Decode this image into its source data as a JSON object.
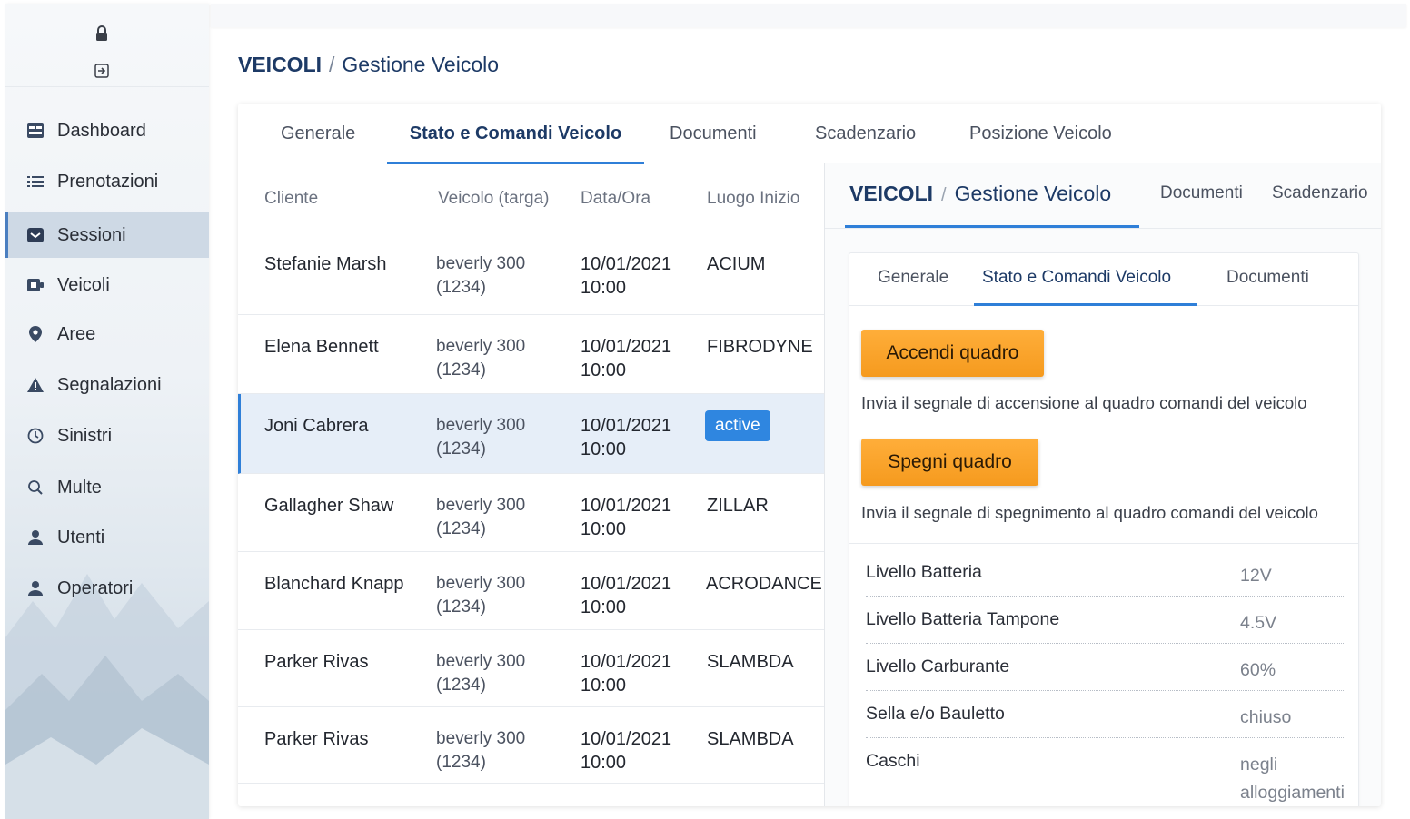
{
  "sidebar": {
    "icons": {
      "lock": "lock-icon",
      "exit": "exit-icon"
    },
    "items": [
      {
        "label": "Dashboard",
        "icon": "dashboard-icon"
      },
      {
        "label": "Prenotazioni",
        "icon": "list-icon"
      },
      {
        "label": "Sessioni",
        "icon": "sessions-icon",
        "active": true
      },
      {
        "label": "Veicoli",
        "icon": "vehicle-icon"
      },
      {
        "label": "Aree",
        "icon": "map-pin-icon"
      },
      {
        "label": "Segnalazioni",
        "icon": "warning-icon"
      },
      {
        "label": "Sinistri",
        "icon": "clock-icon"
      },
      {
        "label": "Multe",
        "icon": "search-icon"
      },
      {
        "label": "Utenti",
        "icon": "user-icon"
      },
      {
        "label": "Operatori",
        "icon": "user-icon"
      }
    ]
  },
  "breadcrumb": {
    "section": "VEICOLI",
    "separator": "/",
    "page": "Gestione Veicolo"
  },
  "tabs": [
    {
      "label": "Generale"
    },
    {
      "label": "Stato e Comandi Veicolo",
      "active": true
    },
    {
      "label": "Documenti"
    },
    {
      "label": "Scadenzario"
    },
    {
      "label": "Posizione Veicolo"
    }
  ],
  "table": {
    "columns": [
      "Cliente",
      "Veicolo (targa)",
      "Data/Ora",
      "Luogo Inizio"
    ],
    "rows": [
      {
        "cliente": "Stefanie Marsh",
        "veicolo": "beverly 300",
        "targa": "(1234)",
        "data": "10/01/2021",
        "ora": "10:00",
        "luogo": "ACIUM"
      },
      {
        "cliente": "Elena Bennett",
        "veicolo": "beverly 300",
        "targa": "(1234)",
        "data": "10/01/2021",
        "ora": "10:00",
        "luogo": "FIBRODYNE"
      },
      {
        "cliente": "Joni Cabrera",
        "veicolo": "beverly 300",
        "targa": "(1234)",
        "data": "10/01/2021",
        "ora": "10:00",
        "luogo": "active",
        "selected": true
      },
      {
        "cliente": "Gallagher Shaw",
        "veicolo": "beverly 300",
        "targa": "(1234)",
        "data": "10/01/2021",
        "ora": "10:00",
        "luogo": "ZILLAR"
      },
      {
        "cliente": "Blanchard Knapp",
        "veicolo": "beverly 300",
        "targa": "(1234)",
        "data": "10/01/2021",
        "ora": "10:00",
        "luogo": "ACRODANCE"
      },
      {
        "cliente": "Parker Rivas",
        "veicolo": "beverly 300",
        "targa": "(1234)",
        "data": "10/01/2021",
        "ora": "10:00",
        "luogo": "SLAMBDA"
      },
      {
        "cliente": "Parker Rivas",
        "veicolo": "beverly 300",
        "targa": "(1234)",
        "data": "10/01/2021",
        "ora": "10:00",
        "luogo": "SLAMBDA"
      }
    ]
  },
  "panel": {
    "breadcrumb": {
      "section": "VEICOLI",
      "separator": "/",
      "page": "Gestione Veicolo"
    },
    "tabs": [
      "Documenti",
      "Scadenzario"
    ],
    "inner_tabs": [
      {
        "label": "Generale"
      },
      {
        "label": "Stato e Comandi Veicolo",
        "active": true
      },
      {
        "label": "Documenti"
      }
    ],
    "on_button": "Accendi quadro",
    "on_desc": "Invia il segnale di accensione al quadro comandi del veicolo",
    "off_button": "Spegni quadro",
    "off_desc": "Invia il segnale di spegnimento al quadro comandi del veicolo",
    "specs": [
      {
        "label": "Livello Batteria",
        "value": "12V"
      },
      {
        "label": "Livello Batteria Tampone",
        "value": "4.5V"
      },
      {
        "label": "Livello Carburante",
        "value": "60%"
      },
      {
        "label": "Sella e/o Bauletto",
        "value": "chiuso"
      },
      {
        "label": "Caschi",
        "value": "negli alloggiamenti"
      }
    ]
  },
  "colors": {
    "accent": "#2f7fd8",
    "button": "#f59a1e",
    "heading": "#1d3a66"
  }
}
